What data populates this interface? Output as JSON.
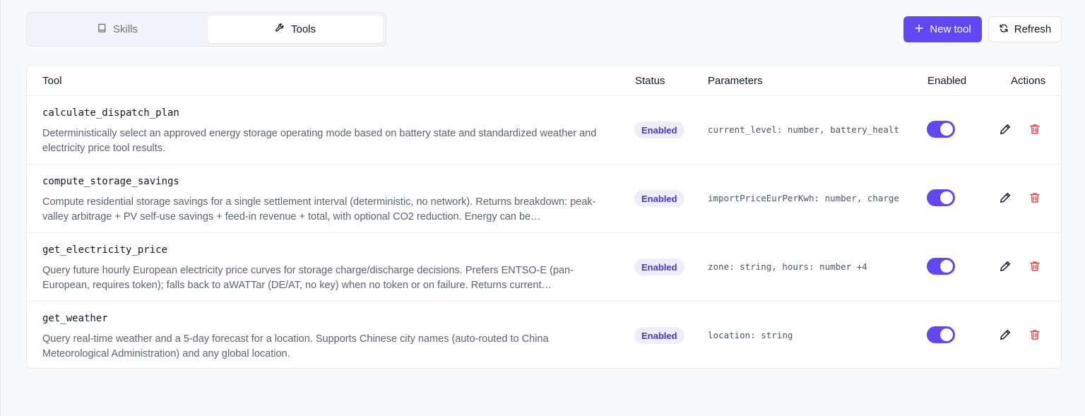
{
  "tabs": [
    {
      "label": "Skills",
      "icon": "book-icon",
      "active": false
    },
    {
      "label": "Tools",
      "icon": "wrench-icon",
      "active": true
    }
  ],
  "toolbar": {
    "new_tool_label": "New tool",
    "refresh_label": "Refresh"
  },
  "table": {
    "headers": {
      "tool": "Tool",
      "status": "Status",
      "parameters": "Parameters",
      "enabled": "Enabled",
      "actions": "Actions"
    },
    "rows": [
      {
        "name": "calculate_dispatch_plan",
        "description": "Deterministically select an approved energy storage operating mode based on battery state and standardized weather and electricity price tool results.",
        "status": "Enabled",
        "parameters": "current_level: number, battery_healt",
        "enabled": true
      },
      {
        "name": "compute_storage_savings",
        "description": "Compute residential storage savings for a single settlement interval (deterministic, no network). Returns breakdown: peak-valley arbitrage + PV self-use savings + feed-in revenue + total, with optional CO2 reduction. Energy can be…",
        "status": "Enabled",
        "parameters": "importPriceEurPerKwh: number, charge",
        "enabled": true
      },
      {
        "name": "get_electricity_price",
        "description": "Query future hourly European electricity price curves for storage charge/discharge decisions. Prefers ENTSO-E (pan-European, requires token); falls back to aWATTar (DE/AT, no key) when no token or on failure. Returns current…",
        "status": "Enabled",
        "parameters": "zone: string, hours: number +4",
        "enabled": true
      },
      {
        "name": "get_weather",
        "description": "Query real-time weather and a 5-day forecast for a location. Supports Chinese city names (auto-routed to China Meteorological Administration) and any global location.",
        "status": "Enabled",
        "parameters": "location: string",
        "enabled": true
      }
    ]
  },
  "colors": {
    "accent": "#6048f6",
    "badge_bg": "#eeedfb",
    "badge_text": "#4338ca",
    "delete": "#e5484d"
  }
}
